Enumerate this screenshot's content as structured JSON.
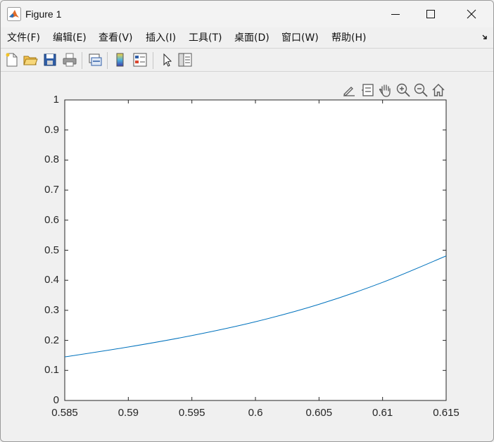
{
  "window": {
    "title": "Figure 1"
  },
  "titlebar_buttons": [
    {
      "name": "minimize-button",
      "icon": "minimize-icon"
    },
    {
      "name": "maximize-button",
      "icon": "maximize-icon"
    },
    {
      "name": "close-button",
      "icon": "close-icon"
    }
  ],
  "menu": {
    "items": [
      {
        "label": "文件(F)"
      },
      {
        "label": "编辑(E)"
      },
      {
        "label": "查看(V)"
      },
      {
        "label": "插入(I)"
      },
      {
        "label": "工具(T)"
      },
      {
        "label": "桌面(D)"
      },
      {
        "label": "窗口(W)"
      },
      {
        "label": "帮助(H)"
      }
    ]
  },
  "toolbar": {
    "buttons": [
      "new-figure-icon",
      "open-file-icon",
      "save-icon",
      "print-icon",
      "link-plot-icon",
      "insert-colorbar-icon",
      "insert-legend-icon",
      "edit-plot-arrow-icon",
      "property-inspector-icon"
    ]
  },
  "axes_toolbar": {
    "buttons": [
      "brush-icon",
      "datatip-icon",
      "pan-icon",
      "zoom-in-icon",
      "zoom-out-icon",
      "home-icon"
    ]
  },
  "colors": {
    "line": "#0072bd",
    "axes": "#262626",
    "background": "#f0f0f0"
  },
  "chart_data": {
    "type": "line",
    "title": "",
    "xlabel": "",
    "ylabel": "",
    "xlim": [
      0.585,
      0.615
    ],
    "ylim": [
      0,
      1
    ],
    "xticks": [
      0.585,
      0.59,
      0.595,
      0.6,
      0.605,
      0.61,
      0.615
    ],
    "xtick_labels": [
      "0.585",
      "0.59",
      "0.595",
      "0.6",
      "0.605",
      "0.61",
      "0.615"
    ],
    "yticks": [
      0,
      0.1,
      0.2,
      0.3,
      0.4,
      0.5,
      0.6,
      0.7,
      0.8,
      0.9,
      1
    ],
    "ytick_labels": [
      "0",
      "0.1",
      "0.2",
      "0.3",
      "0.4",
      "0.5",
      "0.6",
      "0.7",
      "0.8",
      "0.9",
      "1"
    ],
    "grid": false,
    "series": [
      {
        "color": "#0072bd",
        "x": [
          0.585,
          0.59,
          0.595,
          0.6,
          0.605,
          0.61,
          0.615
        ],
        "y": [
          0.145,
          0.178,
          0.216,
          0.262,
          0.32,
          0.393,
          0.481
        ]
      }
    ]
  }
}
